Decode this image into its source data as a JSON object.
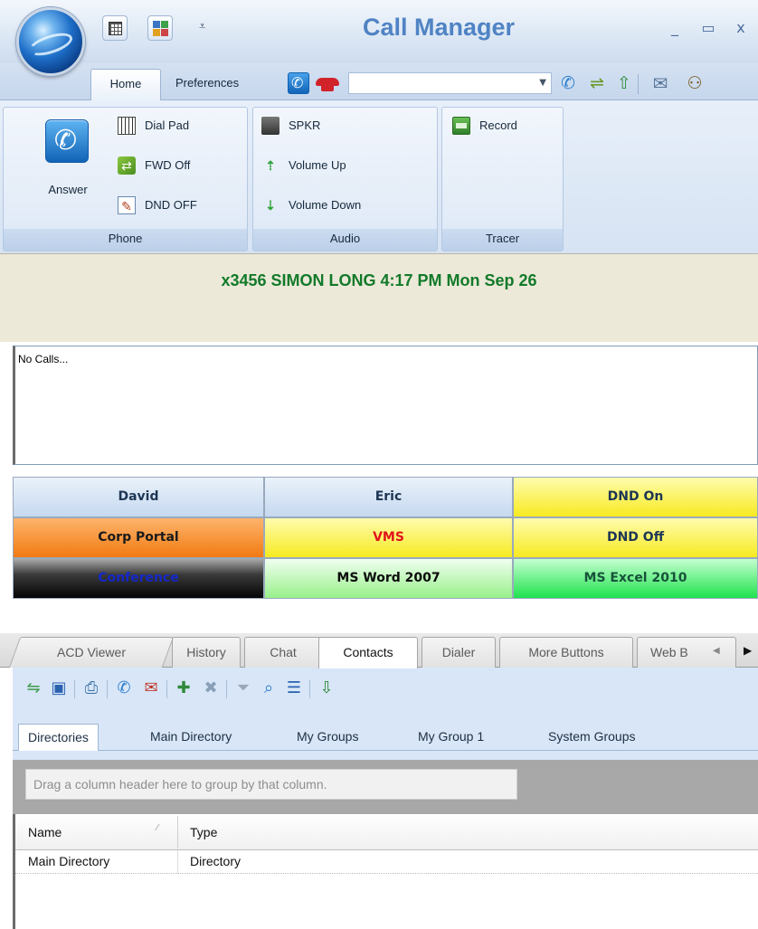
{
  "window": {
    "title": "Call Manager",
    "minimize": "_",
    "maximize": "▭",
    "close": "x"
  },
  "quick_access": {
    "more": "⩡"
  },
  "ribbon_tabs": [
    "Home",
    "Preferences"
  ],
  "toolbar": {
    "number_input_value": "",
    "icons": [
      "phone-icon",
      "hangup-icon",
      "phone-incoming-icon",
      "transfer-icon",
      "pickup-icon",
      "mail-icon",
      "users-icon"
    ]
  },
  "ribbon": {
    "phone": {
      "label": "Phone",
      "answer": "Answer",
      "dialpad": "Dial Pad",
      "fwd": "FWD Off",
      "dnd": "DND OFF"
    },
    "audio": {
      "label": "Audio",
      "spkr": "SPKR",
      "volume_up": "Volume Up",
      "volume_down": "Volume Down"
    },
    "tracer": {
      "label": "Tracer",
      "record": "Record"
    }
  },
  "status": {
    "text": "x3456 SIMON LONG  4:17 PM Mon Sep 26",
    "color": "#127a2a"
  },
  "calls": {
    "text": "No Calls..."
  },
  "speed_buttons": [
    {
      "label": "David",
      "style": "blue"
    },
    {
      "label": "Eric",
      "style": "blue"
    },
    {
      "label": "DND On",
      "style": "yellow"
    },
    {
      "label": "Corp Portal",
      "style": "orange"
    },
    {
      "label": "VMS",
      "style": "yellow",
      "text_color": "#e0141a"
    },
    {
      "label": "DND Off",
      "style": "yellow"
    },
    {
      "label": "Conference",
      "style": "black"
    },
    {
      "label": "MS Word 2007",
      "style": "light-green"
    },
    {
      "label": "MS Excel 2010",
      "style": "green"
    }
  ],
  "lower_tabs": {
    "acd": "ACD Viewer",
    "history": "History",
    "chat": "Chat",
    "contacts": "Contacts",
    "dialer": "Dialer",
    "more": "More Buttons",
    "web": "Web B",
    "active": "Contacts"
  },
  "contacts_toolbar": {
    "icons": [
      "import-icon",
      "save-icon",
      "print-icon",
      "call-icon",
      "chat-icon",
      "add-contact-icon",
      "remove-contact-icon",
      "filter-icon",
      "search-icon",
      "list-icon",
      "export-icon"
    ]
  },
  "sub_tabs": {
    "directories": "Directories",
    "main_directory": "Main Directory",
    "my_groups": "My Groups",
    "my_group_1": "My Group 1",
    "system_groups": "System Groups"
  },
  "grid": {
    "group_hint": "Drag a column header here to group by that column.",
    "columns": [
      "Name",
      "Type"
    ],
    "rows": [
      {
        "name": "Main Directory",
        "type": "Directory"
      }
    ]
  }
}
